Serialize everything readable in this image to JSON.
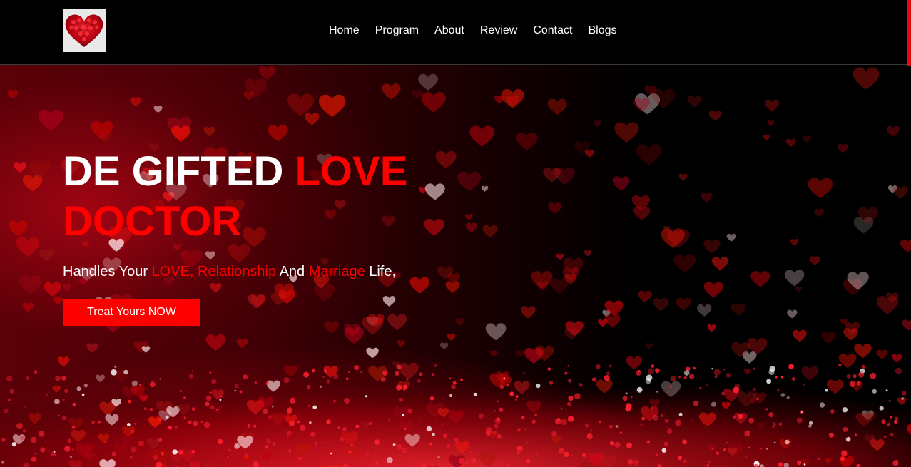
{
  "header": {
    "logo_icon": "heart-of-roses-logo",
    "nav": [
      {
        "label": "Home"
      },
      {
        "label": "Program"
      },
      {
        "label": "About"
      },
      {
        "label": "Review"
      },
      {
        "label": "Contact"
      },
      {
        "label": "Blogs"
      }
    ]
  },
  "hero": {
    "title_white": "DE GIFTED ",
    "title_red": "LOVE DOCTOR",
    "subtitle": {
      "part1": "Handles Your ",
      "love": "LOVE, ",
      "relationship": "Relationship",
      "part2": " And ",
      "marriage": "Marriage",
      "part3": " Life,"
    },
    "cta_label": "Treat Yours NOW",
    "background": "red-bokeh-hearts"
  },
  "colors": {
    "accent": "#ff0000",
    "header_bg": "#000000",
    "text": "#ffffff"
  }
}
